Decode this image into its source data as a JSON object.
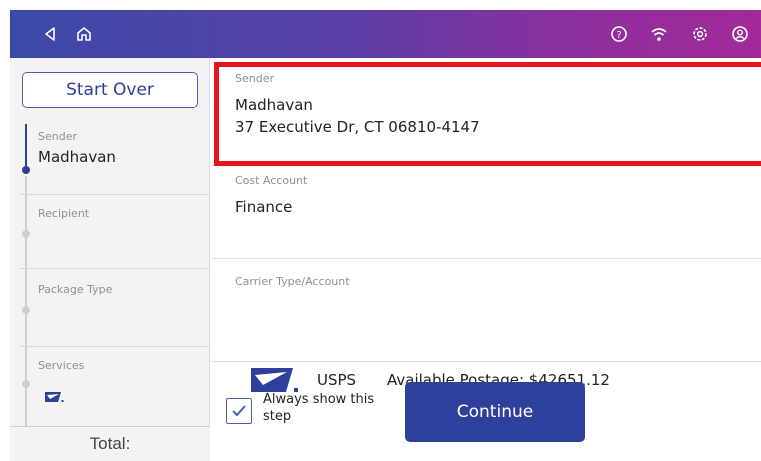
{
  "topbar": {
    "icons": [
      "back-icon",
      "home-icon",
      "help-icon",
      "wifi-icon",
      "settings-icon",
      "account-icon"
    ],
    "gradient_colors": [
      "#3b4aa8",
      "#a32a98"
    ]
  },
  "sidebar": {
    "start_over_label": "Start Over",
    "steps": [
      {
        "label": "Sender",
        "value": "Madhavan"
      },
      {
        "label": "Recipient",
        "value": ""
      },
      {
        "label": "Package Type",
        "value": ""
      },
      {
        "label": "Services",
        "value": ""
      }
    ],
    "total_label": "Total:"
  },
  "main": {
    "sender": {
      "label": "Sender",
      "name": "Madhavan",
      "address": "37 Executive Dr, CT 06810-4147"
    },
    "cost_account": {
      "label": "Cost Account",
      "value": "Finance"
    },
    "carrier": {
      "label": "Carrier Type/Account",
      "name": "USPS",
      "postage": "Available Postage: $42651.12"
    },
    "always_show": {
      "label": "Always show this step",
      "checked": true
    },
    "continue_label": "Continue"
  },
  "colors": {
    "accent": "#2e3f9c",
    "highlight": "#e8141c"
  }
}
